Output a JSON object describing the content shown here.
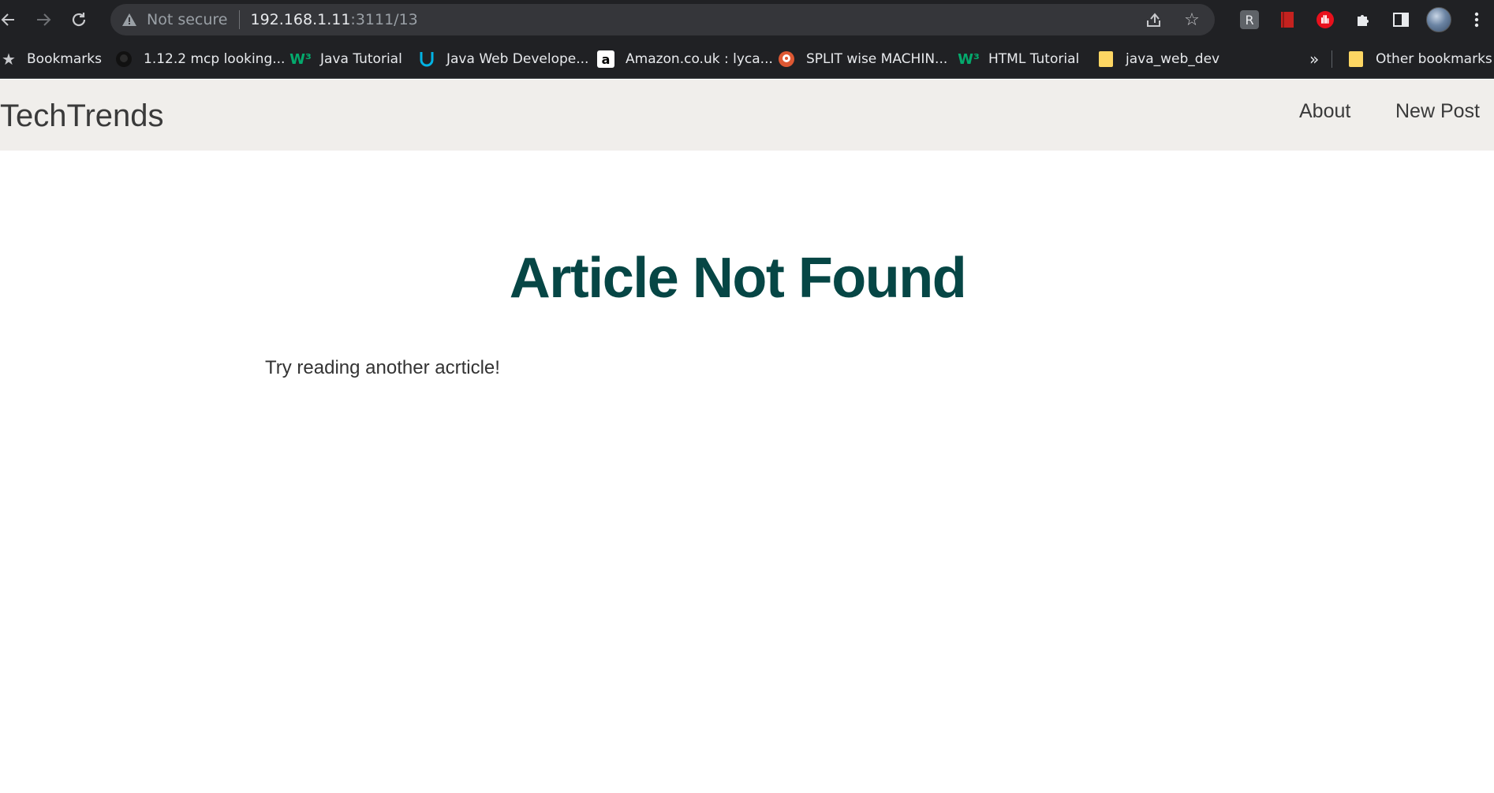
{
  "browser": {
    "security_label": "Not secure",
    "url_host": "192.168.1.11",
    "url_rest": ":3111/13",
    "extension_letter": "R"
  },
  "bookmarks_bar": {
    "items": [
      {
        "label": "Bookmarks",
        "icon": "star-icon"
      },
      {
        "label": "1.12.2 mcp looking...",
        "icon": "github-icon"
      },
      {
        "label": "Java Tutorial",
        "icon": "w3schools-icon"
      },
      {
        "label": "Java Web Develope...",
        "icon": "udacity-icon"
      },
      {
        "label": "Amazon.co.uk : lyca...",
        "icon": "amazon-icon"
      },
      {
        "label": "SPLIT wise MACHIN...",
        "icon": "duckduckgo-icon"
      },
      {
        "label": "HTML Tutorial",
        "icon": "w3schools-icon"
      },
      {
        "label": "java_web_dev",
        "icon": "folder-icon"
      }
    ],
    "overflow": "»",
    "other": "Other bookmarks"
  },
  "site": {
    "brand": "TechTrends",
    "nav": {
      "about": "About",
      "new_post": "New Post"
    }
  },
  "main": {
    "heading": "Article Not Found",
    "message": "Try reading another acrticle!"
  },
  "colors": {
    "heading": "#064645",
    "navbar_bg": "#f0eeeb",
    "chrome_bg": "#202124"
  }
}
